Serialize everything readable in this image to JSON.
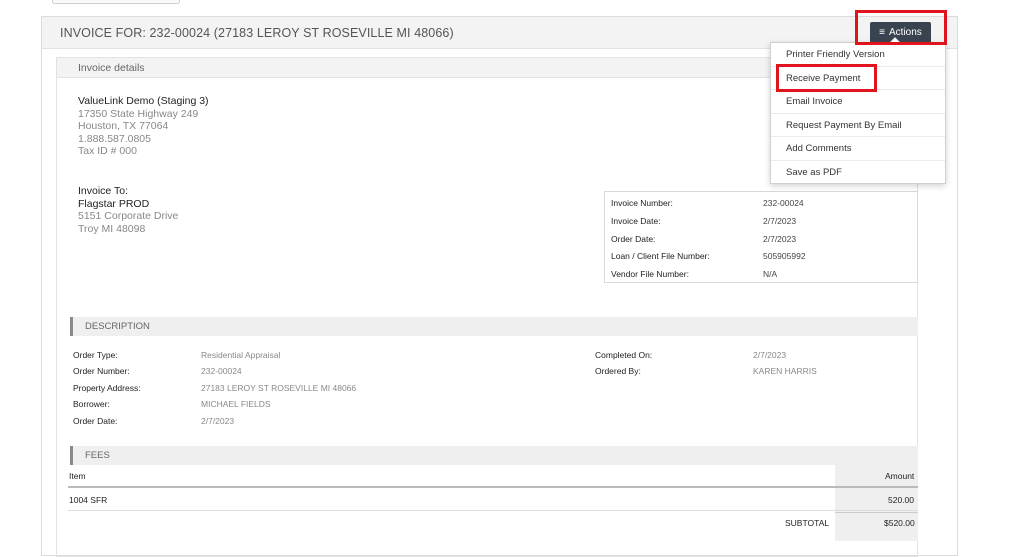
{
  "header": {
    "title": "INVOICE FOR: 232-00024 (27183 LEROY ST ROSEVILLE MI 48066)",
    "actions_label": "Actions",
    "actions_icon": "hamburger-menu-icon"
  },
  "actions_menu": {
    "items": [
      {
        "label": "Printer Friendly Version"
      },
      {
        "label": "Receive Payment"
      },
      {
        "label": "Email Invoice"
      },
      {
        "label": "Request Payment By Email"
      },
      {
        "label": "Add Comments"
      },
      {
        "label": "Save as PDF"
      }
    ]
  },
  "invoice_details": {
    "title": "Invoice details",
    "company": {
      "name": "ValueLink Demo (Staging 3)",
      "address1": "17350 State Highway 249",
      "address2": "Houston, TX 77064",
      "phone": "1.888.587.0805",
      "tax": "Tax ID # 000"
    },
    "bill_to": {
      "label": "Invoice To:",
      "name": "Flagstar PROD",
      "address1": "5151 Corporate Drive",
      "address2": "Troy MI 48098"
    },
    "summary": [
      {
        "label": "Invoice Number:",
        "value": "232-00024"
      },
      {
        "label": "Invoice Date:",
        "value": "2/7/2023"
      },
      {
        "label": "Order Date:",
        "value": "2/7/2023"
      },
      {
        "label": "Loan / Client File Number:",
        "value": "505905992"
      },
      {
        "label": "Vendor File Number:",
        "value": "N/A"
      }
    ]
  },
  "description": {
    "title": "DESCRIPTION",
    "left": [
      {
        "label": "Order Type:",
        "value": "Residential Appraisal"
      },
      {
        "label": "Order Number:",
        "value": "232-00024"
      },
      {
        "label": "Property Address:",
        "value": "27183 LEROY ST ROSEVILLE MI 48066"
      },
      {
        "label": "Borrower:",
        "value": "MICHAEL FIELDS"
      },
      {
        "label": "Order Date:",
        "value": "2/7/2023"
      }
    ],
    "right": [
      {
        "label": "Completed On:",
        "value": "2/7/2023"
      },
      {
        "label": "Ordered By:",
        "value": "KAREN HARRIS"
      }
    ]
  },
  "fees": {
    "title": "FEES",
    "col_item": "Item",
    "col_amount": "Amount",
    "rows": [
      {
        "item": "1004 SFR",
        "amount": "520.00"
      }
    ],
    "subtotal_label": "SUBTOTAL",
    "subtotal_value": "$520.00"
  },
  "highlight_color": "#e0141e",
  "button_color": "#3a4450"
}
